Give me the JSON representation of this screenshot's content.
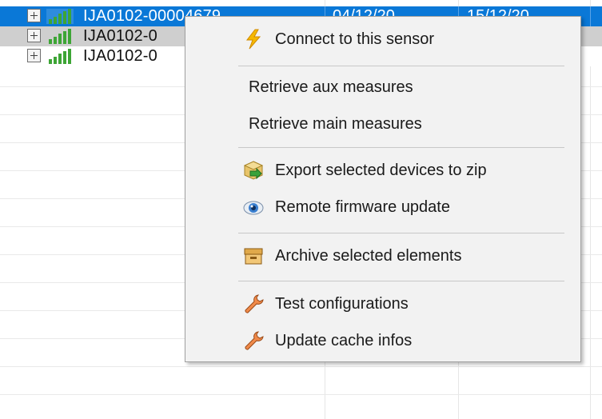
{
  "table": {
    "rows": [
      {
        "id": "IJA0102-00004679",
        "date1": "04/12/20",
        "date2": "15/12/20",
        "selected": true
      },
      {
        "id": "IJA0102-0",
        "hover": true
      },
      {
        "id": "IJA0102-0"
      }
    ]
  },
  "context_menu": {
    "items": [
      {
        "label": "Connect to this sensor",
        "icon": "lightning-icon"
      },
      {
        "label": "Retrieve aux measures"
      },
      {
        "label": "Retrieve main measures"
      },
      {
        "label": "Export selected devices to zip",
        "icon": "export-zip-icon"
      },
      {
        "label": "Remote firmware update",
        "icon": "eye-icon"
      },
      {
        "label": "Archive selected elements",
        "icon": "archive-box-icon"
      },
      {
        "label": "Test configurations",
        "icon": "wrench-icon"
      },
      {
        "label": "Update cache infos",
        "icon": "wrench-icon"
      }
    ]
  },
  "colors": {
    "selection": "#0a78d7",
    "hover_row": "#cfcfcf",
    "signal_bars": "#3da535",
    "menu_bg": "#f2f2f2"
  }
}
